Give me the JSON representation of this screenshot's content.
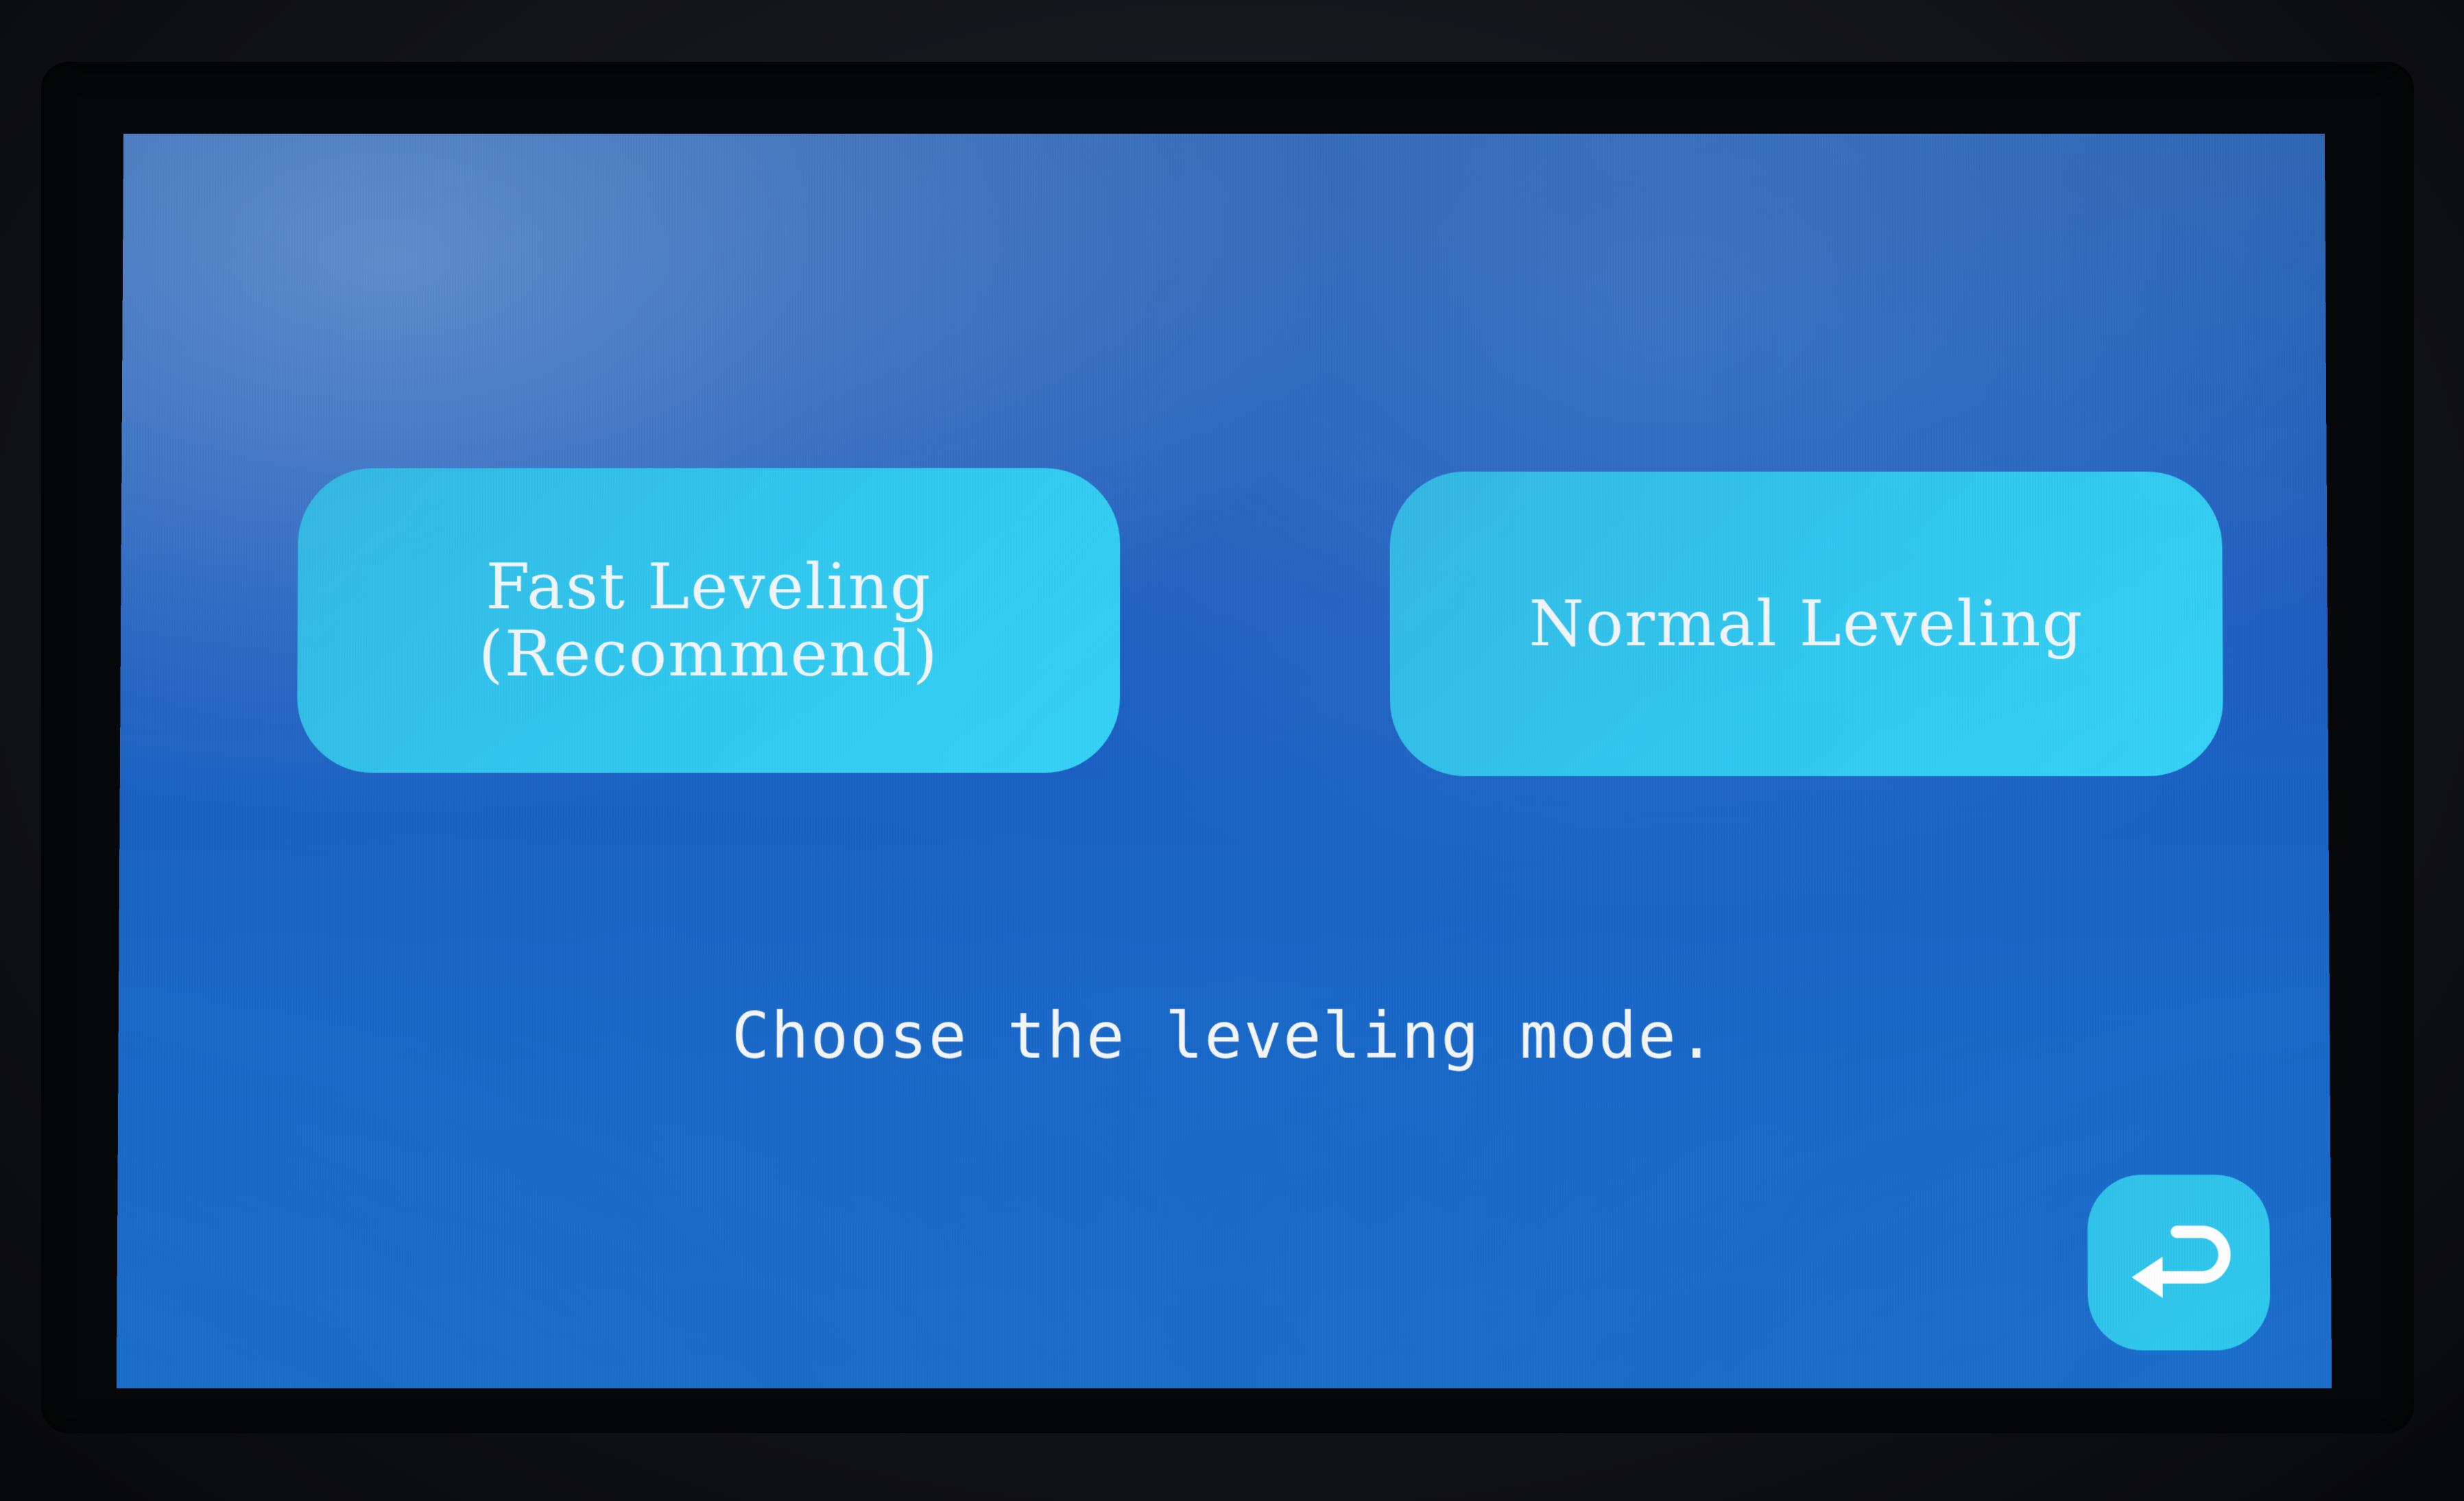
{
  "buttons": {
    "fast_leveling": "Fast Leveling\n(Recommend)",
    "normal_leveling": "Normal Leveling"
  },
  "prompt": "Choose the leveling mode.",
  "back_icon": "return-arrow-icon",
  "colors": {
    "background": "#1a5cc0",
    "button": "#2fc6ee",
    "text": "#f2f6fa"
  }
}
